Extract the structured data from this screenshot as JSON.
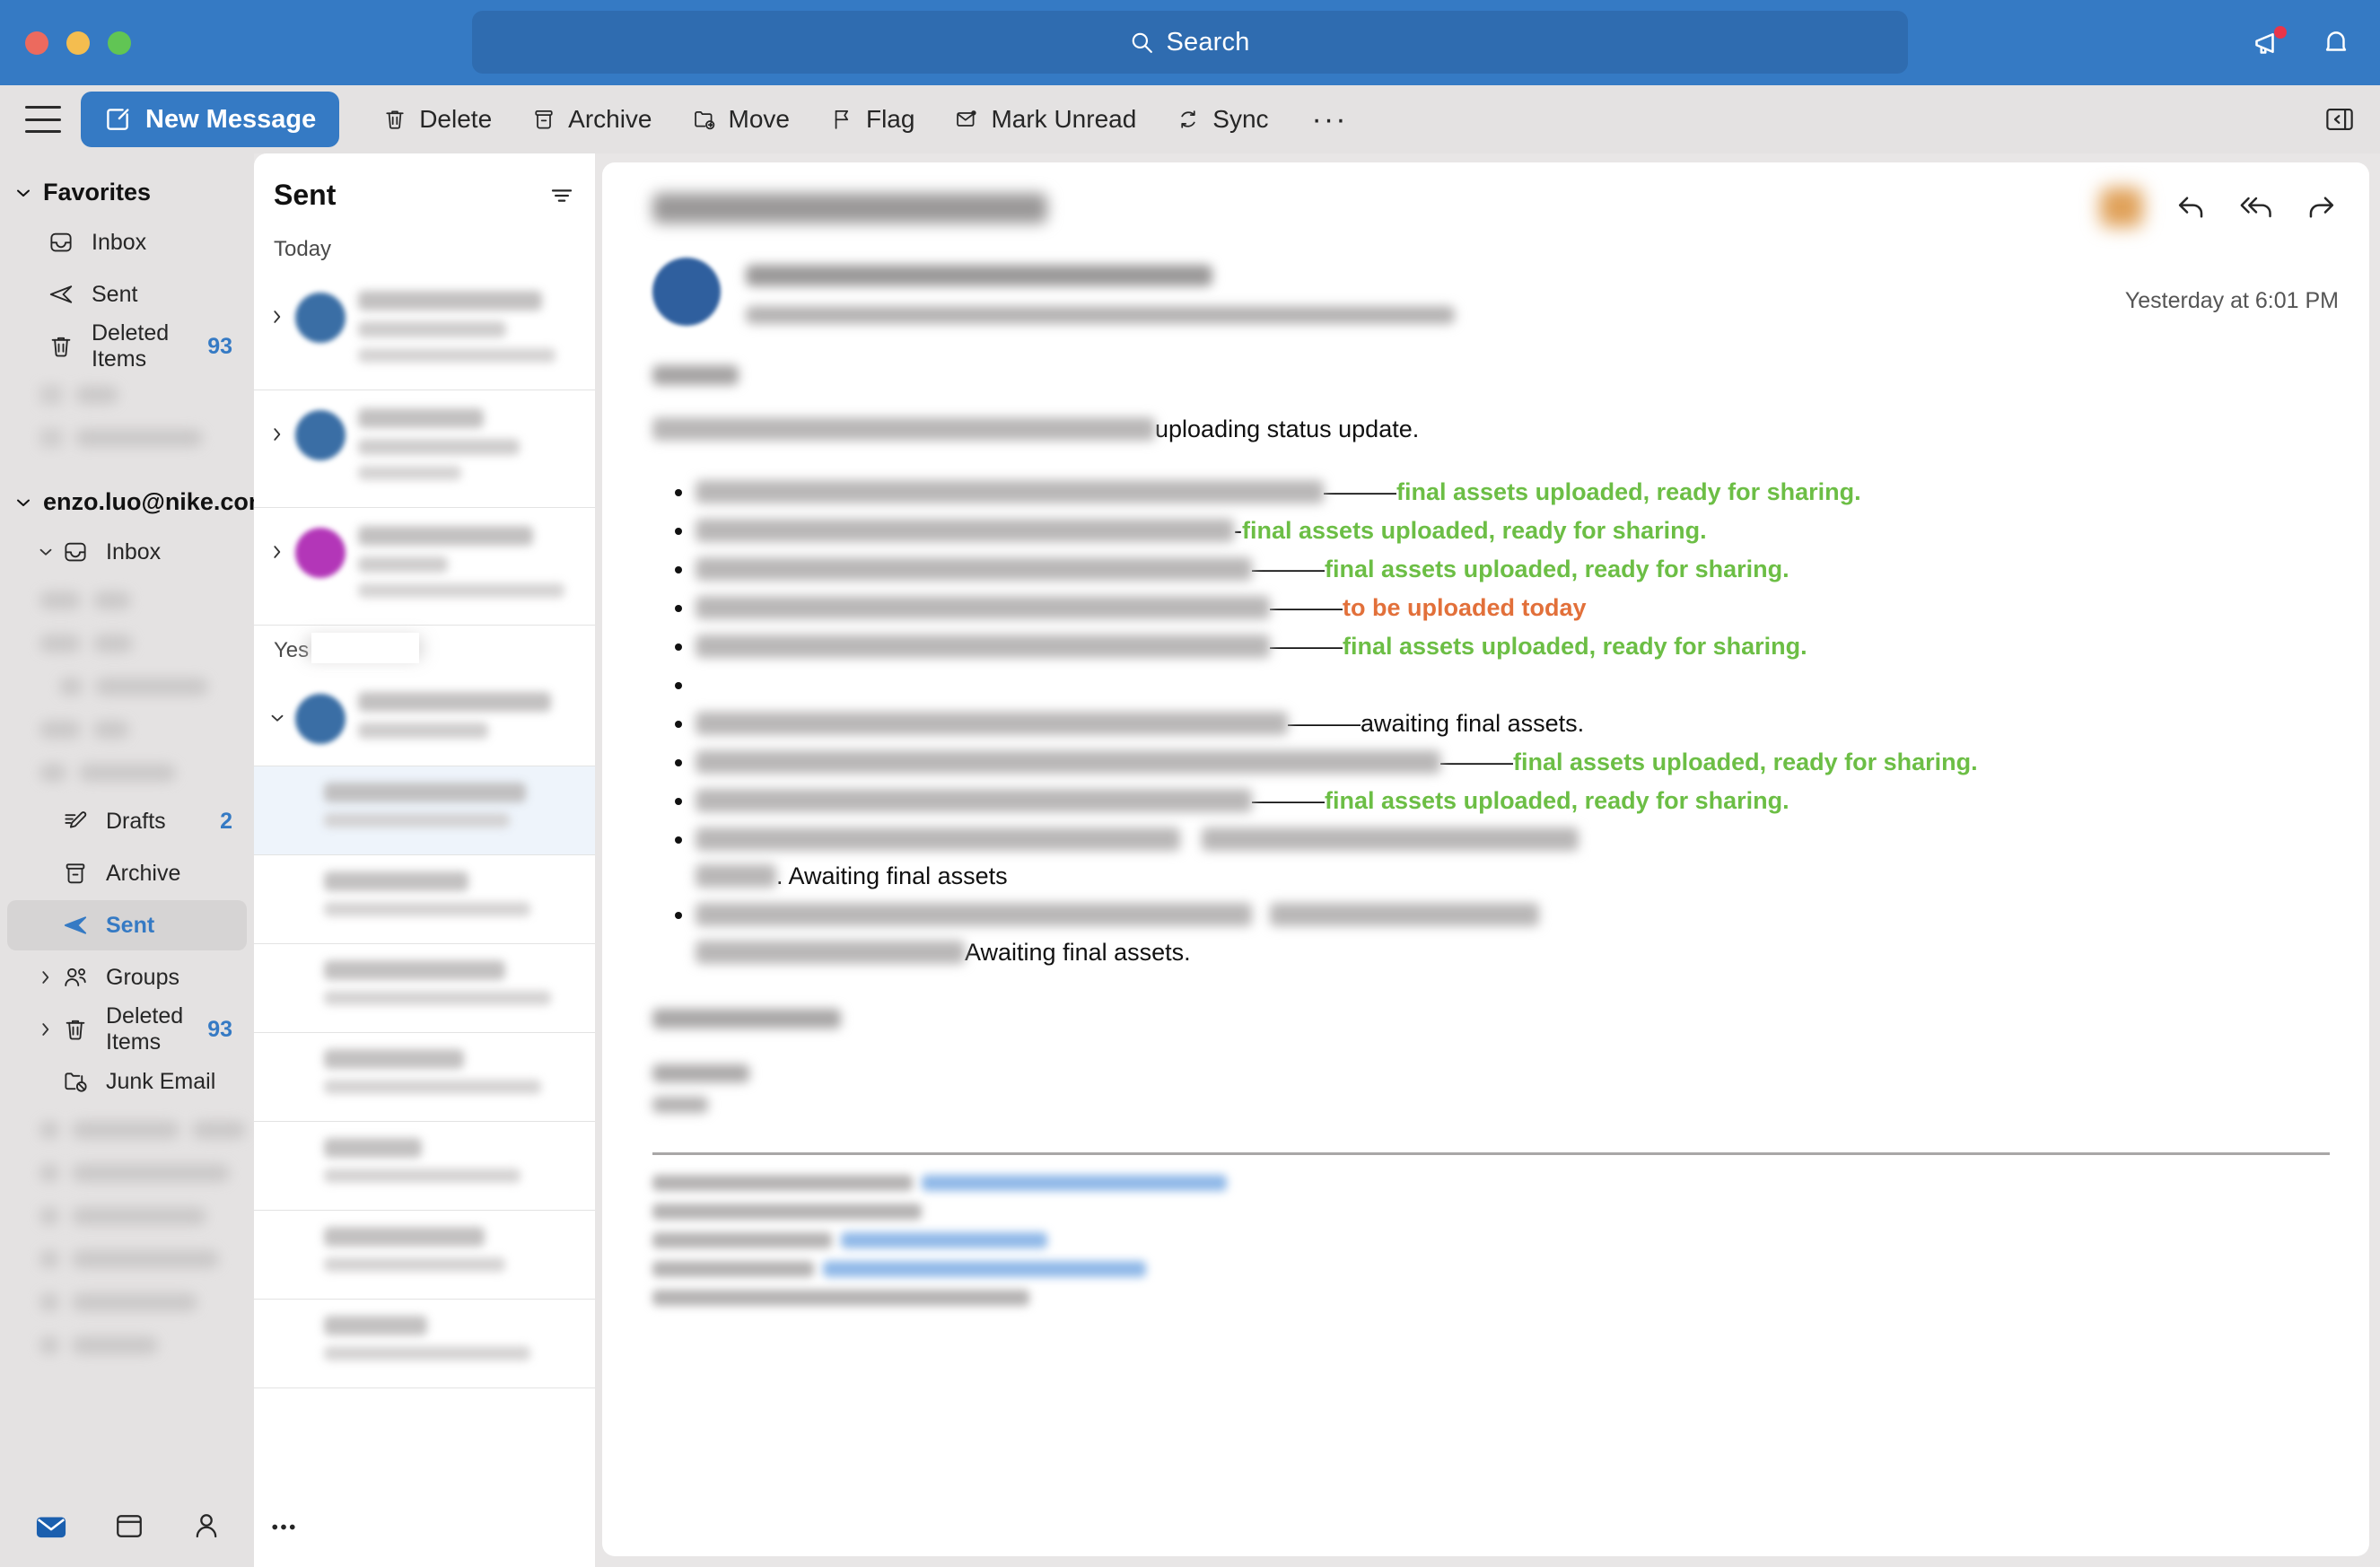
{
  "window": {
    "traffic_lights": [
      "close",
      "minimize",
      "zoom"
    ],
    "accent_blue": "#357ac4"
  },
  "search": {
    "placeholder": "Search",
    "icon": "search-icon"
  },
  "notifications": {
    "announcement_icon": "megaphone-icon",
    "bell_icon": "bell-icon",
    "has_unread_badge": true,
    "badge_color": "#e8354a"
  },
  "toolbar": {
    "menu_icon": "hamburger-icon",
    "new_message": "New Message",
    "buttons": [
      {
        "label": "Delete",
        "icon": "trash-icon"
      },
      {
        "label": "Archive",
        "icon": "archive-box-icon"
      },
      {
        "label": "Move",
        "icon": "folder-arrow-icon"
      },
      {
        "label": "Flag",
        "icon": "flag-icon"
      },
      {
        "label": "Mark Unread",
        "icon": "envelope-dot-icon"
      },
      {
        "label": "Sync",
        "icon": "refresh-icon"
      }
    ],
    "overflow": "···",
    "panel_toggle_icon": "panel-collapse-icon"
  },
  "sidebar": {
    "favorites": {
      "label": "Favorites",
      "expanded": true,
      "items": [
        {
          "label": "Inbox",
          "icon": "inbox-icon",
          "count": ""
        },
        {
          "label": "Sent",
          "icon": "paper-plane-icon",
          "count": ""
        },
        {
          "label": "Deleted Items",
          "icon": "trash-icon",
          "count": "93"
        }
      ]
    },
    "account": {
      "label": "enzo.luo@nike.com",
      "expanded": true,
      "items": [
        {
          "label": "Inbox",
          "icon": "inbox-icon",
          "count": "",
          "expanded": true
        },
        {
          "label": "Drafts",
          "icon": "pencil-lines-icon",
          "count": "2"
        },
        {
          "label": "Archive",
          "icon": "archive-box-icon",
          "count": ""
        },
        {
          "label": "Sent",
          "icon": "paper-plane-icon",
          "count": "",
          "selected": true
        },
        {
          "label": "Groups",
          "icon": "people-icon",
          "count": "",
          "collapsed": true
        },
        {
          "label": "Deleted Items",
          "icon": "trash-icon",
          "count": "93",
          "collapsed": true
        },
        {
          "label": "Junk Email",
          "icon": "folder-block-icon",
          "count": ""
        }
      ]
    },
    "bottom_nav": [
      {
        "icon": "mail-icon",
        "active": true
      },
      {
        "icon": "calendar-icon",
        "active": false
      },
      {
        "icon": "person-icon",
        "active": false
      },
      {
        "icon": "more-dots-icon",
        "active": false
      }
    ]
  },
  "message_list": {
    "title": "Sent",
    "filter_icon": "filter-icon",
    "groups": [
      {
        "label": "Today",
        "rows": 3
      },
      {
        "label": "Yes",
        "partially_obscured": true,
        "rows": 8
      }
    ]
  },
  "reader": {
    "subject_redacted": true,
    "timestamp": "Yesterday at 6:01 PM",
    "actions": [
      {
        "icon": "reply-icon"
      },
      {
        "icon": "reply-all-icon"
      },
      {
        "icon": "forward-icon"
      }
    ],
    "intro_visible_text": "uploading status update.",
    "bullets": [
      {
        "dash": "———",
        "status": "final assets uploaded, ready for sharing.",
        "color": "green"
      },
      {
        "dash": "-",
        "status": "final assets uploaded, ready for sharing.",
        "color": "green"
      },
      {
        "dash": "———",
        "status": "final assets uploaded, ready for sharing.",
        "color": "green"
      },
      {
        "dash": "———",
        "status": "to be uploaded today",
        "color": "orange"
      },
      {
        "dash": "———",
        "status": "final assets uploaded, ready for sharing.",
        "color": "green"
      },
      {
        "dash": "",
        "status": "",
        "color": "none"
      },
      {
        "dash": "———",
        "status": "awaiting final assets.",
        "color": "black"
      },
      {
        "dash": "———",
        "status": "final assets uploaded, ready for sharing.",
        "color": "green"
      },
      {
        "dash": "———",
        "status": "final assets uploaded, ready for sharing.",
        "color": "green"
      },
      {
        "dash": "",
        "status": ". Awaiting final assets",
        "color": "black"
      },
      {
        "dash": "",
        "status": "Awaiting final assets.",
        "color": "black"
      }
    ],
    "colors": {
      "green": "#6cbe45",
      "orange": "#e2703a",
      "black": "#111111"
    }
  }
}
